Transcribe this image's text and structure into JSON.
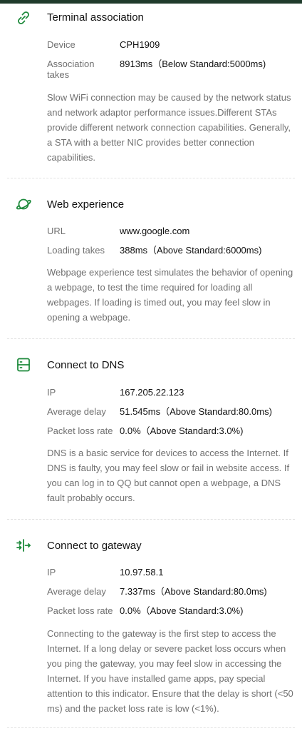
{
  "accent_color": "#1e8a3c",
  "sections": [
    {
      "icon": "link-icon",
      "title": "Terminal association",
      "rows": [
        {
          "label": "Device",
          "value": "CPH1909"
        },
        {
          "label": "Association\ntakes",
          "value": "8913ms（Below Standard:5000ms)"
        }
      ],
      "desc": "Slow WiFi connection may be caused by the network status and network adaptor performance issues.Different STAs provide different network connection capabilities. Generally, a STA with a better NIC provides better connection capabilities."
    },
    {
      "icon": "planet-icon",
      "title": "Web experience",
      "rows": [
        {
          "label": "URL",
          "value": "www.google.com"
        },
        {
          "label": "Loading takes",
          "value": "388ms（Above Standard:6000ms)"
        }
      ],
      "desc": "Webpage experience test simulates the behavior of opening a webpage, to test the time required for loading all webpages. If loading is timed out, you may feel slow in opening a webpage."
    },
    {
      "icon": "server-icon",
      "title": "Connect to DNS",
      "rows": [
        {
          "label": "IP",
          "value": "167.205.22.123"
        },
        {
          "label": "Average delay",
          "value": "51.545ms（Above Standard:80.0ms)"
        },
        {
          "label": "Packet loss rate",
          "value": "0.0%（Above Standard:3.0%)"
        }
      ],
      "desc": "DNS is a basic service for devices to access the Internet. If DNS is faulty, you may feel slow or fail in website access. If you can log in to QQ but cannot open a webpage, a DNS fault probably occurs."
    },
    {
      "icon": "gateway-icon",
      "title": "Connect to gateway",
      "rows": [
        {
          "label": "IP",
          "value": "10.97.58.1"
        },
        {
          "label": "Average delay",
          "value": "7.337ms（Above Standard:80.0ms)"
        },
        {
          "label": "Packet loss rate",
          "value": "0.0%（Above Standard:3.0%)"
        }
      ],
      "desc": "Connecting to the gateway is the first step to access the Internet. If a long delay or severe packet loss occurs when you ping the gateway, you may feel slow in accessing the Internet. If you have installed game apps, pay special attention to this indicator. Ensure that the delay is short (<50 ms) and the packet loss rate is low (<1%)."
    }
  ]
}
